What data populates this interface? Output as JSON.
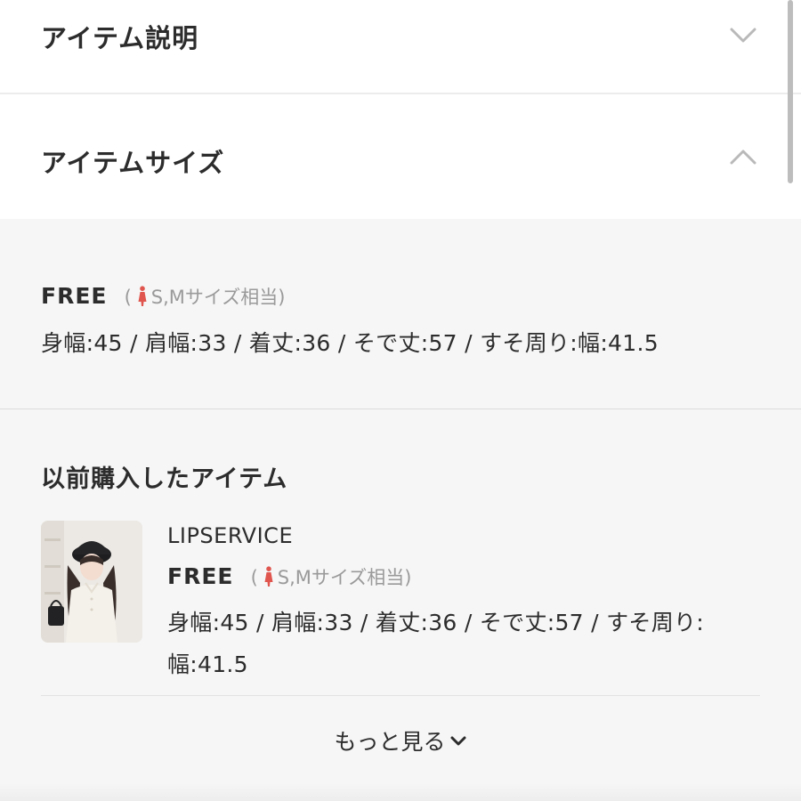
{
  "accordion": {
    "description_title": "アイテム説明",
    "size_title": "アイテムサイズ"
  },
  "item_size": {
    "size_name": "FREE",
    "equiv_open": "(",
    "equiv_text": "S,Mサイズ相当)",
    "measurements": "身幅:45 / 肩幅:33 / 着丈:36 / そで丈:57 / すそ周り:幅:41.5"
  },
  "previous": {
    "title": "以前購入したアイテム",
    "item": {
      "brand": "LIPSERVICE",
      "size_name": "FREE",
      "equiv_open": "(",
      "equiv_text": "S,Mサイズ相当)",
      "measurements_line1": "身幅:45 / 肩幅:33 / 着丈:36 / そで丈:57 / すそ周り:",
      "measurements_line2": "幅:41.5"
    }
  },
  "more_link": "もっと見る",
  "colors": {
    "person_icon": "#e0564f",
    "panel_bg": "#f6f6f6",
    "chevron": "#b9b9b9"
  },
  "icons": {
    "accordion_collapsed": "chevron-down-icon",
    "accordion_expanded": "chevron-up-icon",
    "size_person": "person-icon",
    "more": "chevron-down-icon"
  }
}
